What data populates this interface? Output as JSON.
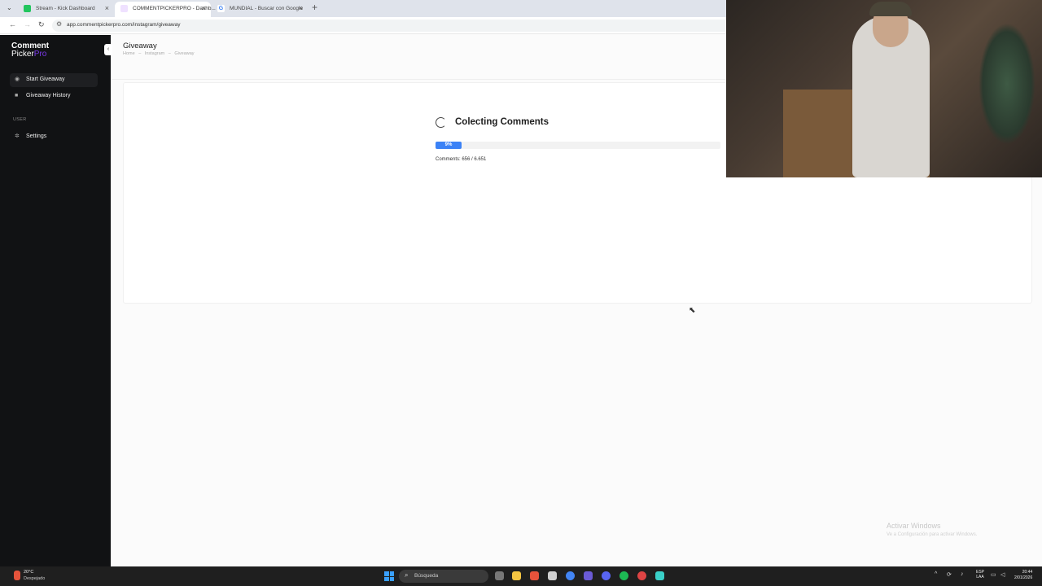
{
  "browser": {
    "tabs": [
      {
        "label": "Stream - Kick Dashboard",
        "active": false,
        "favicon_color": "#22c55e"
      },
      {
        "label": "COMMENTPICKERPRO - Dashb...",
        "active": true,
        "favicon_color": "#f0e4ff"
      },
      {
        "label": "MUNDIAL - Buscar con Google",
        "active": false,
        "favicon_color": "#e8eaed"
      }
    ],
    "url": "app.commentpickerpro.com/instagram/giveaway"
  },
  "sidebar": {
    "logo_line1": "Comment",
    "logo_line2_a": "Picker",
    "logo_line2_b": "Pro",
    "items": [
      {
        "label": "Start Giveaway",
        "icon": "target-icon",
        "active": true
      },
      {
        "label": "Giveaway History",
        "icon": "history-icon",
        "active": false
      }
    ],
    "section_user": "USER",
    "settings_label": "Settings"
  },
  "header": {
    "title": "Giveaway",
    "breadcrumb": [
      "Home",
      "Instagram",
      "Giveaway"
    ],
    "separator": "–"
  },
  "main": {
    "status_title": "Colecting Comments",
    "progress_percent": 9,
    "progress_label": "9%",
    "comments_text": "Comments: 656 / 6.651"
  },
  "watermark": {
    "title": "Activar Windows",
    "subtitle": "Ve a Configuración para activar Windows."
  },
  "taskbar": {
    "weather_temp": "20°C",
    "weather_desc": "Despejado",
    "search_placeholder": "Búsqueda",
    "lang_line1": "ESP",
    "lang_line2": "LAA",
    "time": "20:44",
    "date": "2/01/2026"
  },
  "colors": {
    "accent": "#3b82f6",
    "brand_purple": "#7c3aed",
    "sidebar_bg": "#111214"
  }
}
